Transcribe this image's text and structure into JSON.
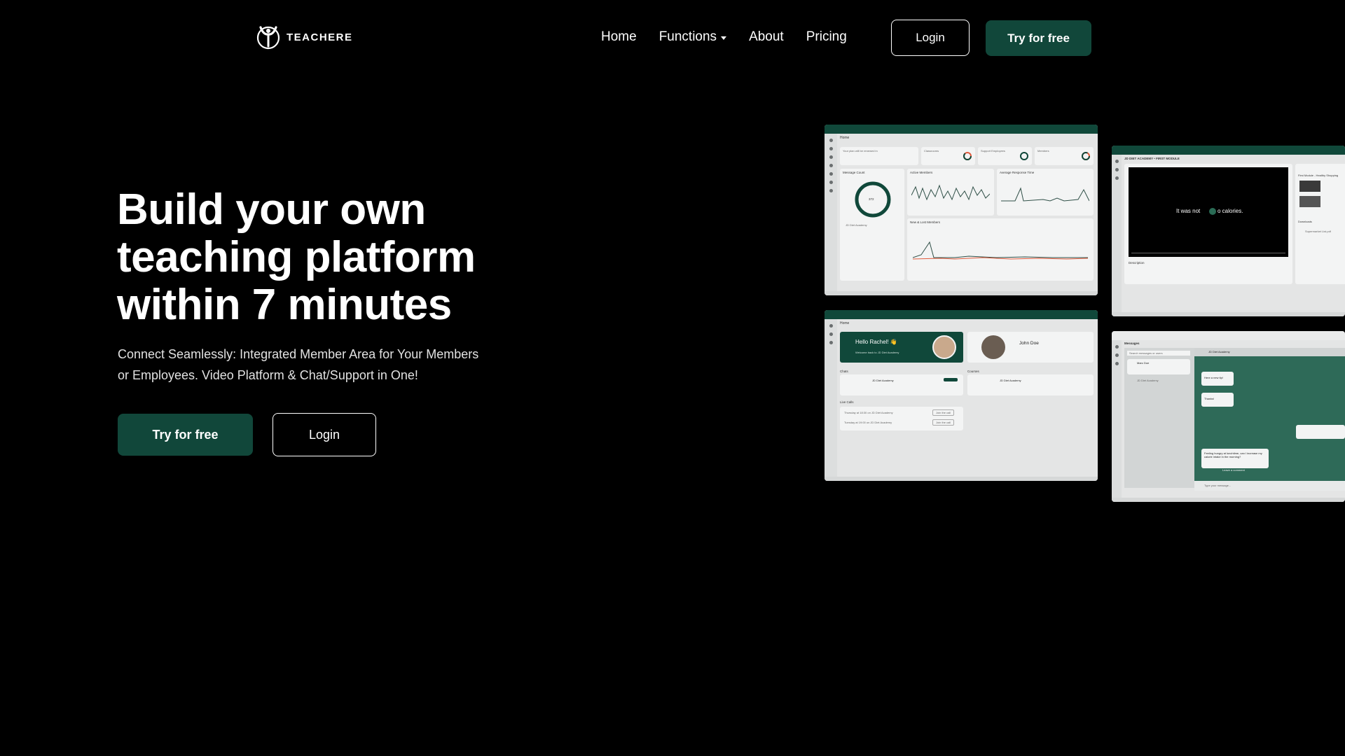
{
  "brand": {
    "name": "TEACHERE"
  },
  "nav": {
    "items": [
      {
        "label": "Home"
      },
      {
        "label": "Functions"
      },
      {
        "label": "About"
      },
      {
        "label": "Pricing"
      }
    ],
    "login_label": "Login",
    "try_label": "Try for free"
  },
  "hero": {
    "headline_1": "Build your own",
    "headline_2": "teaching platform",
    "headline_3": "within 7 minutes",
    "subline_1": "Connect Seamlessly: Integrated Member Area for Your Members",
    "subline_2": "or Employees. Video Platform & Chat/Support in One!",
    "try_label": "Try for free",
    "login_label": "Login"
  },
  "screens": {
    "dashboard": {
      "header": "Home",
      "card1": "Your plan will be renewed in",
      "card2": "Classrooms",
      "card3": "Support Employees",
      "card4": "Members",
      "panel1": "Message Count",
      "donut_value": "372",
      "panel2": "Active Members",
      "panel3": "Average Response Time",
      "panel4": "New & Lost Members",
      "academy": "JD Diet Academy"
    },
    "video": {
      "header": "JD DIET ACADEMY • FIRST MODULE",
      "caption": "It was not",
      "caption_end": "o calories.",
      "description": "Description",
      "sidebar_title": "First Module - Healthy Shopping",
      "downloads": "Downloads",
      "download_item": "Supermarket List.pdf"
    },
    "welcome": {
      "header": "Home",
      "greeting": "Hello Rachel! 👋",
      "greeting_sub": "Welcome back to JD Diet Academy",
      "profile_name": "John Doe",
      "chats": "Chats",
      "courses": "Courses",
      "academy": "JD Diet Academy",
      "live_calls": "Live Calls",
      "call_1": "Thursday at 18:30 on JD Diet Academy",
      "call_2": "Tuesday at 19:00 on JD Diet Academy",
      "join_label": "Join the call"
    },
    "chat": {
      "header": "Messages",
      "search_placeholder": "Search messages or users",
      "contact": "Marc Doe",
      "academy": "JD Diet Academy",
      "msg_1": "Here a new tip!",
      "msg_2": "Thanks!",
      "msg_3": "Feeling hungry at lunchtime, can I increase my calorie intake in the morning?",
      "input_placeholder": "Type your message...",
      "comment_label": "Leave a comment"
    }
  },
  "colors": {
    "accent": "#11473a",
    "background": "#000000",
    "text": "#ffffff"
  }
}
